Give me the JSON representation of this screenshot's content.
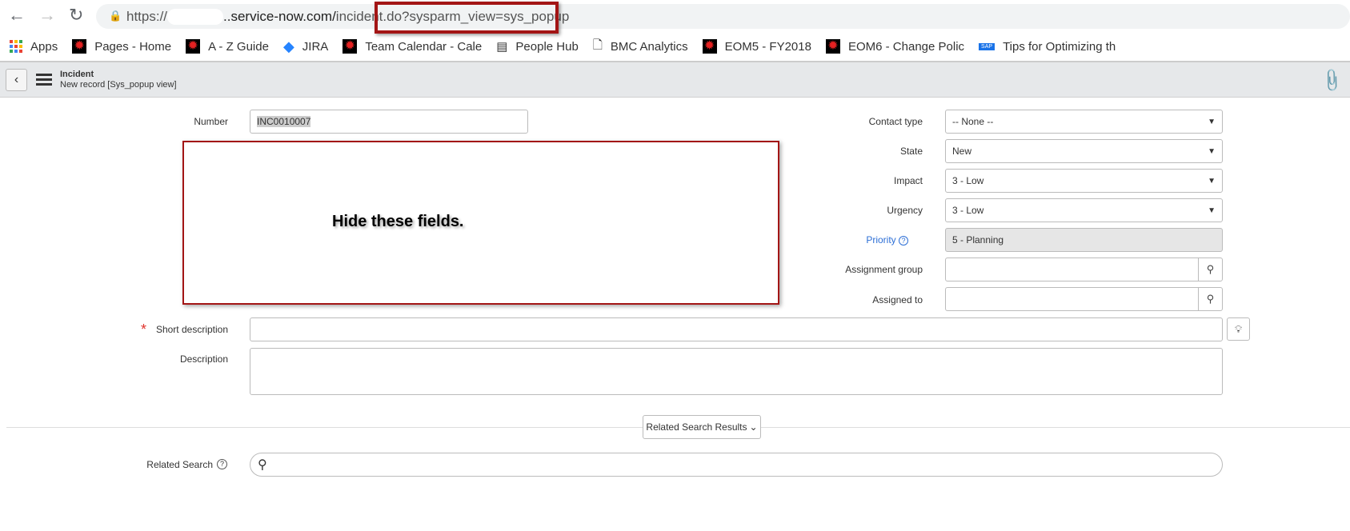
{
  "browser": {
    "url_scheme": "https://",
    "url_host": "..service-now.com/",
    "url_path": "incident.do?sysparm_view=sys_popup",
    "bookmarks": [
      {
        "label": "Apps",
        "icon": "apps-grid-icon"
      },
      {
        "label": "Pages - Home",
        "icon": "red-star-icon"
      },
      {
        "label": "A - Z Guide",
        "icon": "red-star-icon"
      },
      {
        "label": "JIRA",
        "icon": "jira-icon"
      },
      {
        "label": "Team Calendar - Cale",
        "icon": "red-star-icon"
      },
      {
        "label": "People Hub",
        "icon": "document-icon"
      },
      {
        "label": "BMC Analytics",
        "icon": "page-icon"
      },
      {
        "label": "EOM5 - FY2018",
        "icon": "red-star-icon"
      },
      {
        "label": "EOM6 - Change Polic",
        "icon": "red-star-icon"
      },
      {
        "label": "Tips for Optimizing th",
        "icon": "sap-icon"
      }
    ]
  },
  "header": {
    "title": "Incident",
    "subtitle": "New record [Sys_popup view]"
  },
  "form": {
    "number": {
      "label": "Number",
      "value": "INC0010007"
    },
    "annotation": "Hide these fields.",
    "contact_type": {
      "label": "Contact type",
      "value": "-- None --"
    },
    "state": {
      "label": "State",
      "value": "New"
    },
    "impact": {
      "label": "Impact",
      "value": "3 - Low"
    },
    "urgency": {
      "label": "Urgency",
      "value": "3 - Low"
    },
    "priority": {
      "label": "Priority",
      "value": "5 - Planning"
    },
    "assignment_group": {
      "label": "Assignment group",
      "value": ""
    },
    "assigned_to": {
      "label": "Assigned to",
      "value": ""
    },
    "short_description": {
      "label": "Short description",
      "value": ""
    },
    "description": {
      "label": "Description",
      "value": ""
    },
    "related_results_label": "Related Search Results",
    "related_search": {
      "label": "Related Search",
      "value": ""
    }
  },
  "colors": {
    "annotation_red": "#a31515",
    "priority_link": "#2d6fd6",
    "required": "#e0332d"
  }
}
